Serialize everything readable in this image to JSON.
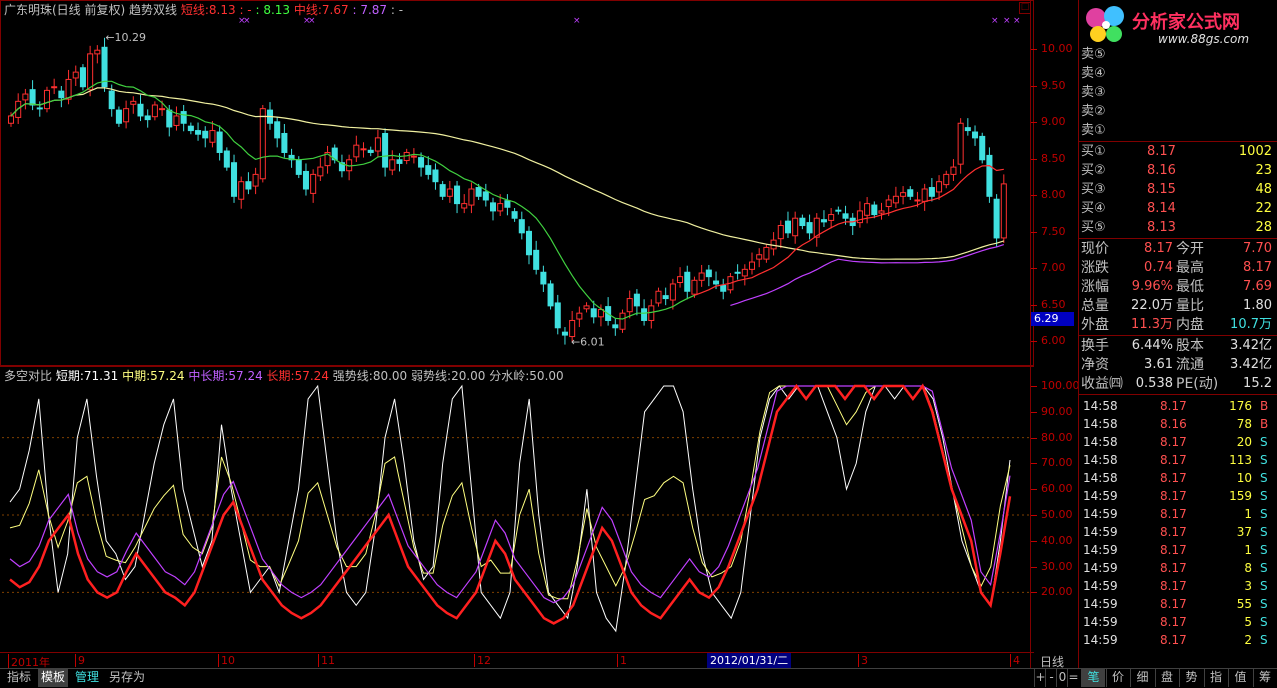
{
  "header": {
    "title": "广东明珠(日线 前复权)",
    "indicator": "趋势双线",
    "short_label": "短线:",
    "short_value": "8.13",
    "short_extra": ": -",
    "short_value2": ": 8.13",
    "mid_label": "中线:",
    "mid_value": "7.67",
    "mid_value2": ": 7.87",
    "mid_extra": ": -"
  },
  "lower_header": {
    "name": "多空对比",
    "short_label": "短期:",
    "short_value": "71.31",
    "mid_label": "中期:",
    "mid_value": "57.24",
    "midlong_label": "中长期:",
    "midlong_value": "57.24",
    "long_label": "长期:",
    "long_value": "57.24",
    "strong_label": "强势线:",
    "strong_value": "80.00",
    "weak_label": "弱势线:",
    "weak_value": "20.00",
    "split_label": "分水岭:",
    "split_value": "50.00"
  },
  "price_axis": [
    "10.00",
    "9.50",
    "9.00",
    "8.50",
    "8.00",
    "7.50",
    "7.00",
    "6.50",
    "6.00"
  ],
  "price_marker": "6.29",
  "osc_axis": [
    "100.00",
    "90.00",
    "80.00",
    "70.00",
    "60.00",
    "50.00",
    "40.00",
    "30.00",
    "20.00"
  ],
  "annotations": {
    "high": "10.29",
    "low": "6.01"
  },
  "time_axis": {
    "labels": [
      "2011年",
      "9",
      "10",
      "11",
      "12",
      "1",
      "3",
      "4"
    ],
    "cursor": "2012/01/31/二",
    "period": "日线"
  },
  "logo": {
    "name": "分析家公式网",
    "url": "www.88gs.com"
  },
  "quote": {
    "sells": [
      {
        "label": "卖⑤",
        "price": "",
        "vol": ""
      },
      {
        "label": "卖④",
        "price": "",
        "vol": ""
      },
      {
        "label": "卖③",
        "price": "",
        "vol": ""
      },
      {
        "label": "卖②",
        "price": "",
        "vol": ""
      },
      {
        "label": "卖①",
        "price": "",
        "vol": ""
      }
    ],
    "buys": [
      {
        "label": "买①",
        "price": "8.17",
        "vol": "1002"
      },
      {
        "label": "买②",
        "price": "8.16",
        "vol": "23"
      },
      {
        "label": "买③",
        "price": "8.15",
        "vol": "48"
      },
      {
        "label": "买④",
        "price": "8.14",
        "vol": "22"
      },
      {
        "label": "买⑤",
        "price": "8.13",
        "vol": "28"
      }
    ],
    "stats": [
      {
        "l1": "现价",
        "v1": "8.17",
        "l2": "今开",
        "v2": "7.70"
      },
      {
        "l1": "涨跌",
        "v1": "0.74",
        "l2": "最高",
        "v2": "8.17"
      },
      {
        "l1": "涨幅",
        "v1": "9.96%",
        "l2": "最低",
        "v2": "7.69"
      },
      {
        "l1": "总量",
        "v1": "22.0万",
        "l2": "量比",
        "v2": "1.80"
      },
      {
        "l1": "外盘",
        "v1": "11.3万",
        "l2": "内盘",
        "v2": "10.7万"
      },
      {
        "l1": "换手",
        "v1": "6.44%",
        "l2": "股本",
        "v2": "3.42亿"
      },
      {
        "l1": "净资",
        "v1": "3.61",
        "l2": "流通",
        "v2": "3.42亿"
      },
      {
        "l1": "收益㈣",
        "v1": "0.538",
        "l2": "PE(动)",
        "v2": "15.2"
      }
    ],
    "trades": [
      {
        "t": "14:58",
        "p": "8.17",
        "v": "176",
        "s": "B"
      },
      {
        "t": "14:58",
        "p": "8.16",
        "v": "78",
        "s": "B"
      },
      {
        "t": "14:58",
        "p": "8.17",
        "v": "20",
        "s": "S"
      },
      {
        "t": "14:58",
        "p": "8.17",
        "v": "113",
        "s": "S"
      },
      {
        "t": "14:58",
        "p": "8.17",
        "v": "10",
        "s": "S"
      },
      {
        "t": "14:59",
        "p": "8.17",
        "v": "159",
        "s": "S"
      },
      {
        "t": "14:59",
        "p": "8.17",
        "v": "1",
        "s": "S"
      },
      {
        "t": "14:59",
        "p": "8.17",
        "v": "37",
        "s": "S"
      },
      {
        "t": "14:59",
        "p": "8.17",
        "v": "1",
        "s": "S"
      },
      {
        "t": "14:59",
        "p": "8.17",
        "v": "8",
        "s": "S"
      },
      {
        "t": "14:59",
        "p": "8.17",
        "v": "3",
        "s": "S"
      },
      {
        "t": "14:59",
        "p": "8.17",
        "v": "55",
        "s": "S"
      },
      {
        "t": "14:59",
        "p": "8.17",
        "v": "5",
        "s": "S"
      },
      {
        "t": "14:59",
        "p": "8.17",
        "v": "2",
        "s": "S"
      }
    ]
  },
  "bottom_tabs": [
    "指标",
    "模板",
    "管理",
    "另存为"
  ],
  "zoom_controls": [
    "+",
    "-",
    "0",
    "="
  ],
  "right_tabs": [
    "笔",
    "价",
    "细",
    "盘",
    "势",
    "指",
    "值",
    "筹"
  ],
  "chart_data": {
    "type": "candlestick",
    "price_range": [
      5.8,
      10.4
    ],
    "closes": [
      9.1,
      9.3,
      9.4,
      9.25,
      9.2,
      9.45,
      9.5,
      9.35,
      9.6,
      9.7,
      9.5,
      9.95,
      10.0,
      9.5,
      9.2,
      9.0,
      9.2,
      9.3,
      9.1,
      9.05,
      9.25,
      9.2,
      8.95,
      9.1,
      9.0,
      8.9,
      8.85,
      8.8,
      8.9,
      8.6,
      8.4,
      8.0,
      8.2,
      8.1,
      8.3,
      9.2,
      9.0,
      8.8,
      8.6,
      8.5,
      8.3,
      8.1,
      8.3,
      8.4,
      8.6,
      8.5,
      8.35,
      8.5,
      8.7,
      8.65,
      8.6,
      8.8,
      8.4,
      8.5,
      8.45,
      8.6,
      8.55,
      8.4,
      8.3,
      8.2,
      8.0,
      8.1,
      7.9,
      7.9,
      8.1,
      8.0,
      7.95,
      7.8,
      7.9,
      7.85,
      7.7,
      7.5,
      7.2,
      7.0,
      6.8,
      6.5,
      6.2,
      6.1,
      6.3,
      6.4,
      6.5,
      6.35,
      6.45,
      6.3,
      6.2,
      6.4,
      6.6,
      6.5,
      6.3,
      6.5,
      6.7,
      6.6,
      6.8,
      6.9,
      6.7,
      6.85,
      6.95,
      6.9,
      6.8,
      6.7,
      6.9,
      6.95,
      7.0,
      7.1,
      7.2,
      7.3,
      7.4,
      7.6,
      7.5,
      7.7,
      7.6,
      7.5,
      7.7,
      7.65,
      7.75,
      7.8,
      7.7,
      7.6,
      7.8,
      7.9,
      7.75,
      7.8,
      7.95,
      8.0,
      8.05,
      8.0,
      7.95,
      8.1,
      8.0,
      8.2,
      8.3,
      8.4,
      9.0,
      8.9,
      8.8,
      8.5,
      8.0,
      7.43,
      8.17
    ],
    "short_line": [
      8.13
    ],
    "mid_line": [
      7.67
    ],
    "osc_range": [
      0,
      100
    ],
    "osc_short": [
      55,
      60,
      75,
      95,
      50,
      20,
      35,
      80,
      95,
      65,
      40,
      35,
      25,
      30,
      50,
      70,
      85,
      95,
      60,
      45,
      30,
      40,
      85,
      60,
      40,
      20,
      25,
      30,
      20,
      40,
      60,
      95,
      100,
      70,
      40,
      20,
      15,
      20,
      45,
      80,
      95,
      70,
      40,
      25,
      30,
      70,
      95,
      100,
      60,
      20,
      15,
      10,
      20,
      70,
      95,
      50,
      20,
      15,
      10,
      30,
      60,
      20,
      10,
      5,
      30,
      60,
      90,
      95,
      100,
      100,
      90,
      60,
      35,
      20,
      15,
      10,
      20,
      50,
      80,
      95,
      100,
      95,
      100,
      100,
      100,
      90,
      80,
      60,
      70,
      90,
      100,
      100,
      95,
      100,
      100,
      100,
      95,
      80,
      60,
      40,
      30,
      20,
      15,
      40,
      71.31
    ],
    "osc_long": [
      25,
      22,
      24,
      30,
      40,
      45,
      50,
      35,
      25,
      20,
      18,
      20,
      28,
      35,
      30,
      25,
      20,
      18,
      15,
      20,
      30,
      40,
      50,
      55,
      45,
      35,
      25,
      20,
      15,
      12,
      10,
      12,
      15,
      20,
      25,
      30,
      35,
      40,
      45,
      50,
      40,
      30,
      25,
      20,
      15,
      12,
      10,
      15,
      20,
      30,
      40,
      35,
      25,
      20,
      15,
      10,
      8,
      10,
      15,
      25,
      35,
      45,
      40,
      30,
      20,
      15,
      12,
      10,
      15,
      20,
      25,
      20,
      18,
      22,
      30,
      40,
      50,
      60,
      75,
      90,
      95,
      100,
      95,
      100,
      100,
      100,
      95,
      100,
      100,
      95,
      100,
      100,
      100,
      95,
      100,
      90,
      75,
      60,
      50,
      40,
      20,
      15,
      35,
      57.24
    ],
    "guide_lines": {
      "strong": 80,
      "weak": 20,
      "split": 50
    }
  }
}
